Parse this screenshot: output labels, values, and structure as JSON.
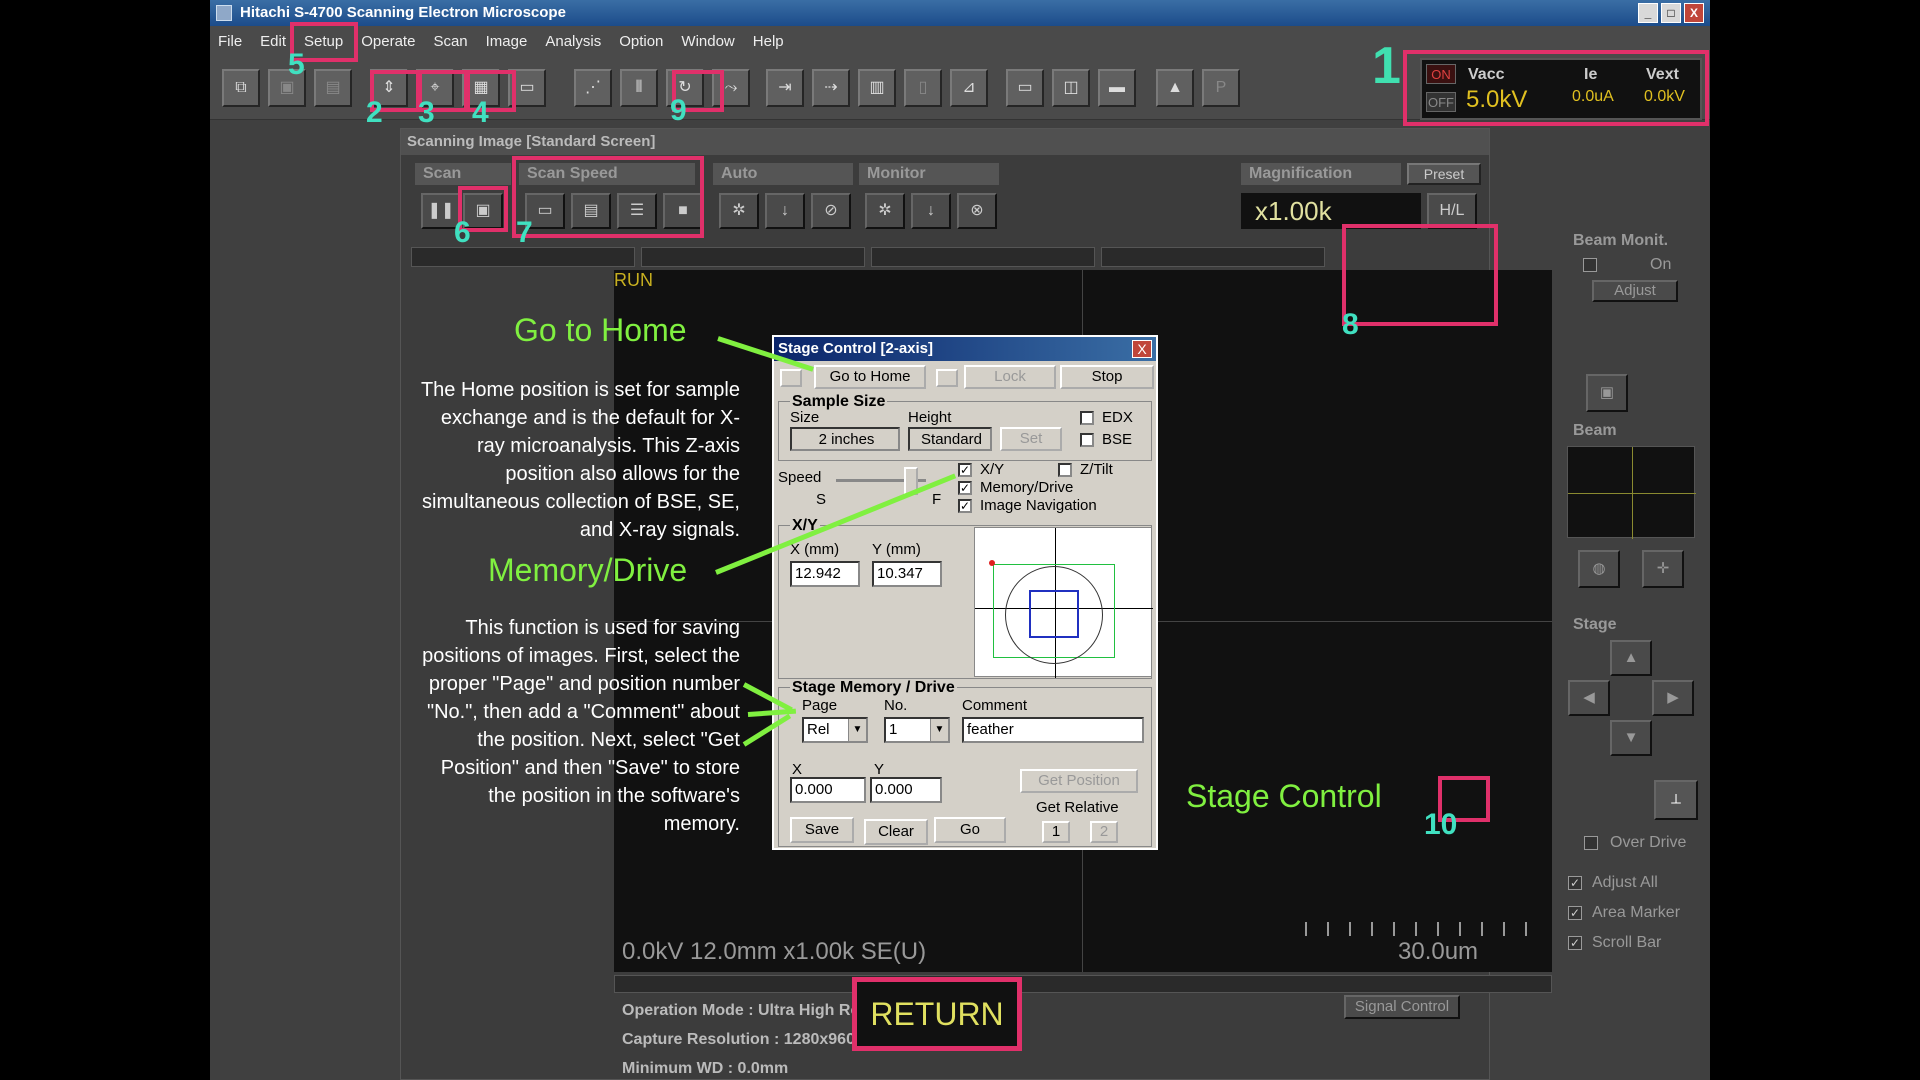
{
  "window": {
    "title": "Hitachi S-4700 Scanning Electron Microscope",
    "min": "_",
    "max": "□",
    "close": "X"
  },
  "menu": [
    "File",
    "Edit",
    "Setup",
    "Operate",
    "Scan",
    "Image",
    "Analysis",
    "Option",
    "Window",
    "Help"
  ],
  "status": {
    "on": "ON",
    "off": "OFF",
    "vacc_label": "Vacc",
    "ie_label": "Ie",
    "vext_label": "Vext",
    "vacc": "5.0kV",
    "ie": "0.0uA",
    "vext": "0.0kV"
  },
  "scan_window": {
    "title": "Scanning Image [Standard Screen]",
    "groups": {
      "scan": "Scan",
      "scan_speed": "Scan Speed",
      "auto": "Auto",
      "monitor": "Monitor",
      "magnification": "Magnification"
    },
    "preset": "Preset",
    "magnification": "x1.00k",
    "hl": "H/L",
    "run": "RUN",
    "info_line": "0.0kV 12.0mm x1.00k SE(U)",
    "scale_bar": "30.0um",
    "operation_mode": "Operation Mode : Ultra High Resolution",
    "capture_resolution": "Capture Resolution : 1280x960",
    "minimum_wd": "Minimum WD : 0.0mm",
    "signal_control": "Signal Control"
  },
  "right_panel": {
    "beam_monit": "Beam Monit.",
    "on": "On",
    "adjust": "Adjust",
    "beam": "Beam",
    "stage": "Stage",
    "over_drive": "Over Drive",
    "adjust_all": "Adjust All",
    "area_marker": "Area Marker",
    "scroll_bar": "Scroll Bar"
  },
  "dialog": {
    "title": "Stage Control [2-axis]",
    "close": "X",
    "go_to_home": "Go to Home",
    "lock": "Lock",
    "stop": "Stop",
    "sample_size": "Sample Size",
    "size_label": "Size",
    "size_value": "2 inches",
    "height_label": "Height",
    "height_value": "Standard",
    "set": "Set",
    "edx": "EDX",
    "bse": "BSE",
    "speed": "Speed",
    "s": "S",
    "f": "F",
    "xy_chk": "X/Y",
    "ztilt": "Z/Tilt",
    "memory_drive_chk": "Memory/Drive",
    "image_navigation": "Image Navigation",
    "xy_group": "X/Y",
    "x_label": "X (mm)",
    "y_label": "Y (mm)",
    "x_value": "12.942",
    "y_value": "10.347",
    "memory_group": "Stage Memory / Drive",
    "page_label": "Page",
    "no_label": "No.",
    "comment_label": "Comment",
    "page_value": "Rel",
    "no_value": "1",
    "comment_value": "feather",
    "x_small": "X",
    "y_small": "Y",
    "x_mem": "0.000",
    "y_mem": "0.000",
    "get_position": "Get Position",
    "get_relative": "Get Relative",
    "rel1": "1",
    "rel2": "2",
    "save": "Save",
    "clear": "Clear",
    "go": "Go"
  },
  "annotations": {
    "n1": "1",
    "n2": "2",
    "n3": "3",
    "n4": "4",
    "n5": "5",
    "n6": "6",
    "n7": "7",
    "n8": "8",
    "n9": "9",
    "n10": "10",
    "go_to_home": "Go to Home",
    "go_to_home_desc": "The Home position is set for sample exchange and is the default for X-ray microanalysis. This Z-axis position also allows for the simultaneous collection of BSE, SE, and X-ray signals.",
    "memory_drive": "Memory/Drive",
    "memory_drive_desc": "This function is used for saving positions of images. First, select the proper \"Page\" and position number \"No.\", then add a \"Comment\" about the position. Next, select \"Get Position\" and then \"Save\" to store the position in the software's memory.",
    "stage_control": "Stage Control",
    "return": "RETURN"
  }
}
